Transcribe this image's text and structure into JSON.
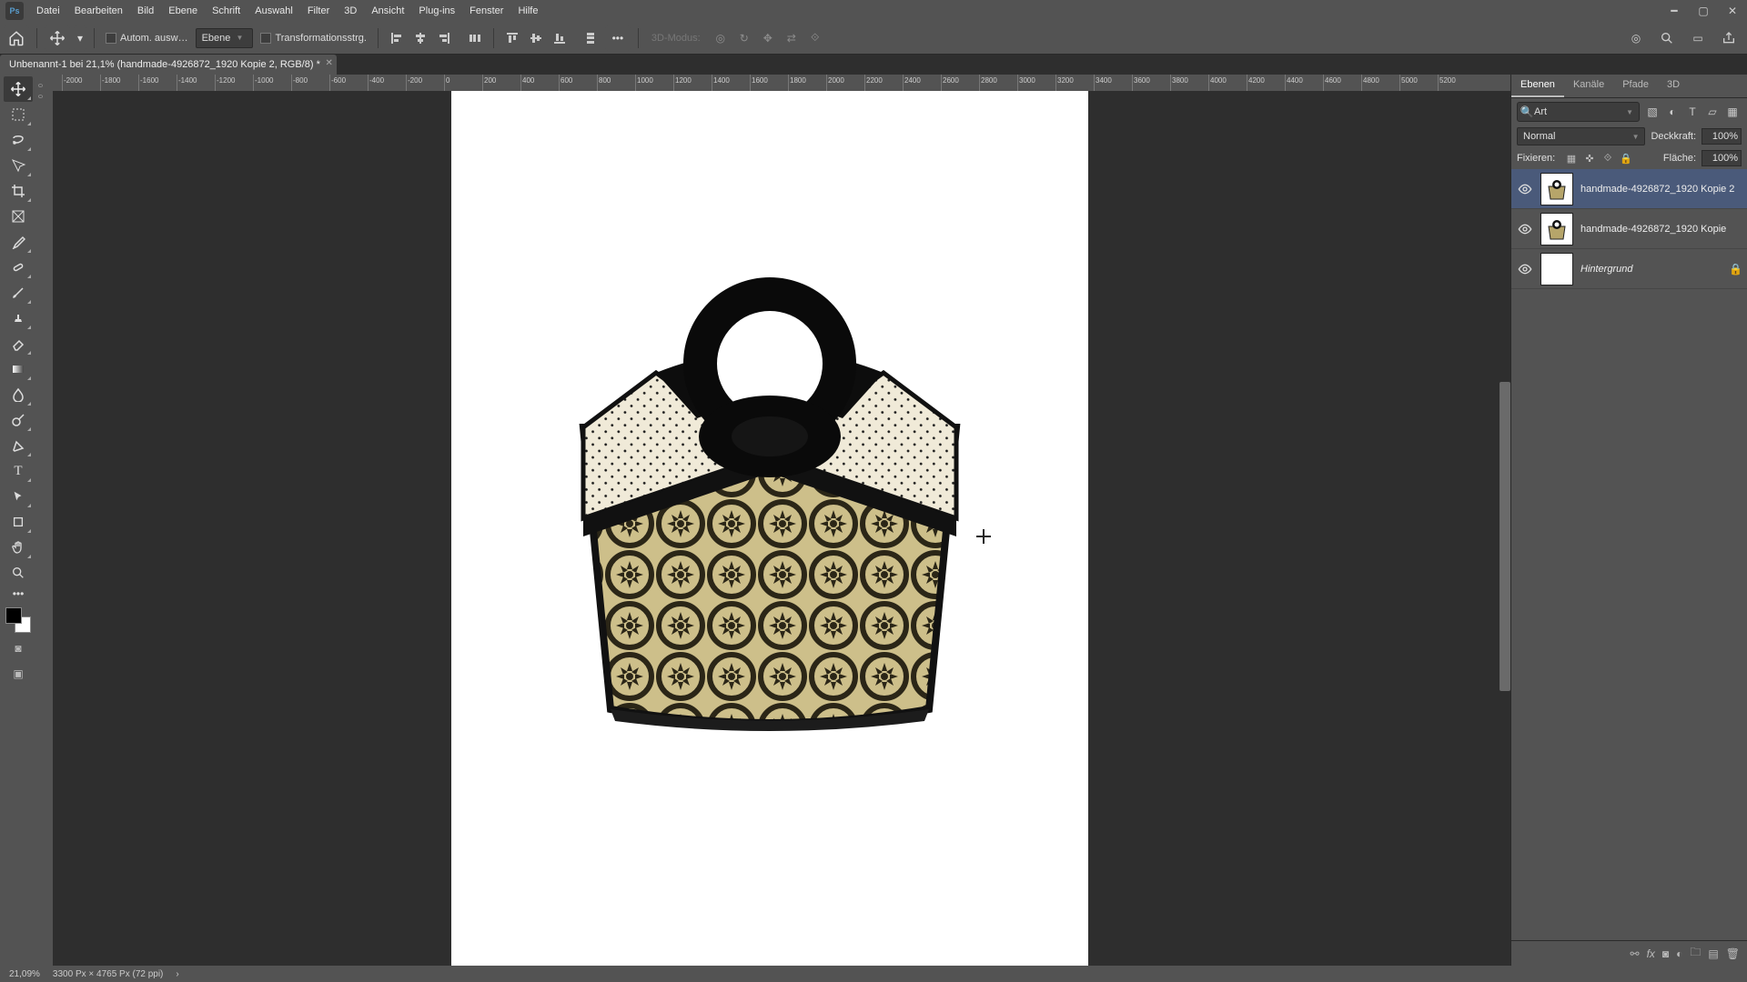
{
  "menu": [
    "Datei",
    "Bearbeiten",
    "Bild",
    "Ebene",
    "Schrift",
    "Auswahl",
    "Filter",
    "3D",
    "Ansicht",
    "Plug-ins",
    "Fenster",
    "Hilfe"
  ],
  "options": {
    "auto_select_label": "Autom. ausw…",
    "target_dropdown": "Ebene",
    "transform_controls_label": "Transformationsstrg.",
    "mode3d_label": "3D-Modus:"
  },
  "doc_tab": "Unbenannt-1 bei 21,1% (handmade-4926872_1920 Kopie 2, RGB/8) *",
  "ruler_h": [
    "-2000",
    "-1800",
    "-1600",
    "-1400",
    "-1200",
    "-1000",
    "-800",
    "-600",
    "-400",
    "-200",
    "0",
    "200",
    "400",
    "600",
    "800",
    "1000",
    "1200",
    "1400",
    "1600",
    "1800",
    "2000",
    "2200",
    "2400",
    "2600",
    "2800",
    "3000",
    "3200",
    "3400",
    "3600",
    "3800",
    "4000",
    "4200",
    "4400",
    "4600",
    "4800",
    "5000",
    "5200"
  ],
  "ruler_v": [
    "0",
    "0"
  ],
  "panel_tabs": [
    "Ebenen",
    "Kanäle",
    "Pfade",
    "3D"
  ],
  "search_kind": "Art",
  "blend": {
    "mode": "Normal",
    "opacity_label": "Deckkraft:",
    "opacity": "100%"
  },
  "lock": {
    "label": "Fixieren:",
    "fill_label": "Fläche:",
    "fill": "100%"
  },
  "layers": [
    {
      "name": "handmade-4926872_1920 Kopie 2",
      "visible": true,
      "locked": false,
      "thumb": "bag",
      "selected": true,
      "italic": false
    },
    {
      "name": "handmade-4926872_1920 Kopie",
      "visible": true,
      "locked": false,
      "thumb": "bag",
      "selected": false,
      "italic": false
    },
    {
      "name": "Hintergrund",
      "visible": true,
      "locked": true,
      "thumb": "white",
      "selected": false,
      "italic": true
    }
  ],
  "status": {
    "zoom": "21,09%",
    "docinfo": "3300 Px × 4765 Px (72 ppi)"
  },
  "icons": {
    "home": "home-icon",
    "move": "move-tool-icon",
    "align": "align-icon",
    "more": "more-icon",
    "search": "search-icon",
    "share": "share-icon",
    "grid": "grid-icon",
    "eye": "eye-icon",
    "lock": "lock-icon",
    "trash": "trash-icon",
    "newlayer": "new-layer-icon",
    "folder": "folder-icon",
    "fx": "fx-icon",
    "mask": "mask-icon",
    "adjust": "adjustment-icon",
    "link": "link-icon"
  }
}
